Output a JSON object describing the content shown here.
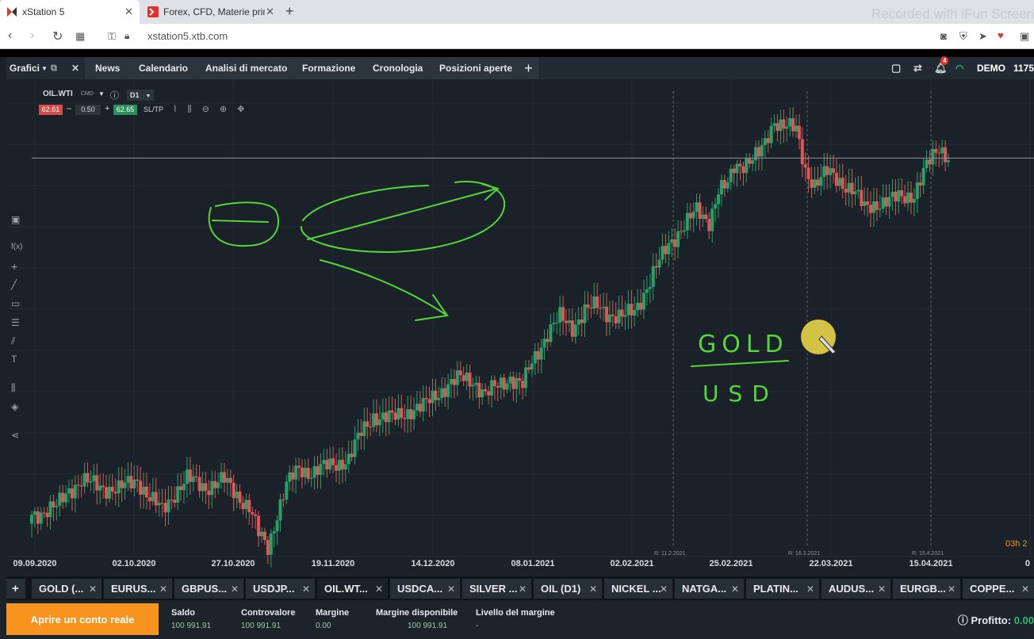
{
  "browser": {
    "tabs": [
      {
        "title": "xStation 5",
        "active": true
      },
      {
        "title": "Forex, CFD, Materie prime,",
        "active": false
      }
    ],
    "url": "xstation5.xtb.com",
    "watermark": "Recorded with iFun Screen"
  },
  "app": {
    "charts_menu": "Grafici",
    "nav_tabs": [
      "News",
      "Calendario",
      "Analisi di mercato",
      "Formazione",
      "Cronologia",
      "Posizioni aperte"
    ],
    "notifications_count": "4",
    "account_label": "DEMO",
    "account_id": "1175"
  },
  "instrument": {
    "symbol": "OIL.WTI",
    "type": "CMD",
    "timeframe": "D1",
    "bid": "62.61",
    "ask": "62.65",
    "volume": "0.50",
    "sltp_label": "SL/TP"
  },
  "chart_data": {
    "type": "candlestick",
    "title": "",
    "x_tick_labels": [
      "09.09.2020",
      "02.10.2020",
      "27.10.2020",
      "19.11.2020",
      "14.12.2020",
      "08.01.2021",
      "02.02.2021",
      "25.02.2021",
      "22.03.2021",
      "15.04.2021",
      "0"
    ],
    "rollover_markers": [
      "R: 11.2.2021",
      "R: 16.3.2021",
      "R: 15.4.2021"
    ],
    "countdown_label": "03h 2",
    "y_range": [
      36.0,
      67.4
    ],
    "current_price": 62.61,
    "close_path": [
      [
        0,
        38.5
      ],
      [
        8,
        39.0
      ],
      [
        12,
        40.2
      ],
      [
        16,
        40.8
      ],
      [
        22,
        40.4
      ],
      [
        28,
        40.2
      ],
      [
        34,
        40.9
      ],
      [
        38,
        39.6
      ],
      [
        42,
        38.8
      ],
      [
        46,
        40.0
      ],
      [
        50,
        40.9
      ],
      [
        56,
        40.4
      ],
      [
        62,
        40.8
      ],
      [
        66,
        39.9
      ],
      [
        70,
        39.0
      ],
      [
        73,
        37.2
      ],
      [
        76,
        36.3
      ],
      [
        79,
        38.6
      ],
      [
        82,
        40.5
      ],
      [
        86,
        41.6
      ],
      [
        90,
        41.4
      ],
      [
        96,
        41.8
      ],
      [
        102,
        42.3
      ],
      [
        106,
        44.0
      ],
      [
        110,
        45.2
      ],
      [
        116,
        45.0
      ],
      [
        122,
        45.6
      ],
      [
        126,
        45.8
      ],
      [
        130,
        46.6
      ],
      [
        134,
        47.3
      ],
      [
        138,
        47.7
      ],
      [
        142,
        47.6
      ],
      [
        146,
        46.6
      ],
      [
        150,
        47.2
      ],
      [
        154,
        47.8
      ],
      [
        158,
        47.2
      ],
      [
        161,
        48.8
      ],
      [
        166,
        50.8
      ],
      [
        170,
        51.8
      ],
      [
        174,
        51.2
      ],
      [
        178,
        52.3
      ],
      [
        182,
        52.6
      ],
      [
        186,
        52.1
      ],
      [
        190,
        51.8
      ],
      [
        194,
        52.3
      ],
      [
        198,
        53.9
      ],
      [
        202,
        55.6
      ],
      [
        205,
        56.8
      ],
      [
        208,
        57.6
      ],
      [
        211,
        58.3
      ],
      [
        214,
        59.0
      ],
      [
        218,
        58.4
      ],
      [
        221,
        60.4
      ],
      [
        224,
        60.7
      ],
      [
        226,
        62.0
      ],
      [
        230,
        62.4
      ],
      [
        234,
        62.8
      ],
      [
        236,
        63.5
      ],
      [
        239,
        65.2
      ],
      [
        242,
        64.9
      ],
      [
        246,
        64.4
      ],
      [
        249,
        61.8
      ],
      [
        252,
        60.9
      ],
      [
        256,
        61.6
      ],
      [
        260,
        61.1
      ],
      [
        264,
        60.5
      ],
      [
        268,
        59.2
      ],
      [
        272,
        59.6
      ],
      [
        276,
        59.7
      ],
      [
        280,
        60.0
      ],
      [
        284,
        60.2
      ],
      [
        288,
        62.0
      ],
      [
        292,
        63.4
      ],
      [
        295,
        62.7
      ]
    ]
  },
  "annotations": {
    "text_top": "GOLD",
    "text_bottom": "USD"
  },
  "instrument_tabs": [
    "GOLD (...",
    "EURUS...",
    "GBPUS...",
    "USDJP...",
    "OIL.WT...",
    "USDCA...",
    "SILVER ...",
    "OIL (D1)",
    "NICKEL ...",
    "NATGA...",
    "PLATIN...",
    "AUDUS...",
    "EURGB...",
    "COPPE..."
  ],
  "active_instrument_tab": 4,
  "account": {
    "cta_label": "Aprire un conto reale",
    "fields": [
      {
        "label": "Saldo",
        "value": "100 991.91"
      },
      {
        "label": "Controvalore",
        "value": "100 991.91"
      },
      {
        "label": "Margine",
        "value": "0.00"
      },
      {
        "label": "Margine disponibile",
        "value": "100 991.91"
      },
      {
        "label": "Livello del margine",
        "value": "-"
      }
    ],
    "profit_label": "Profitto:",
    "profit_value": "0.00"
  },
  "colors": {
    "bull": "#26a269",
    "bear": "#e05555",
    "drawing": "#57d63a",
    "cursor": "#e8d548",
    "cta": "#f7931e"
  }
}
